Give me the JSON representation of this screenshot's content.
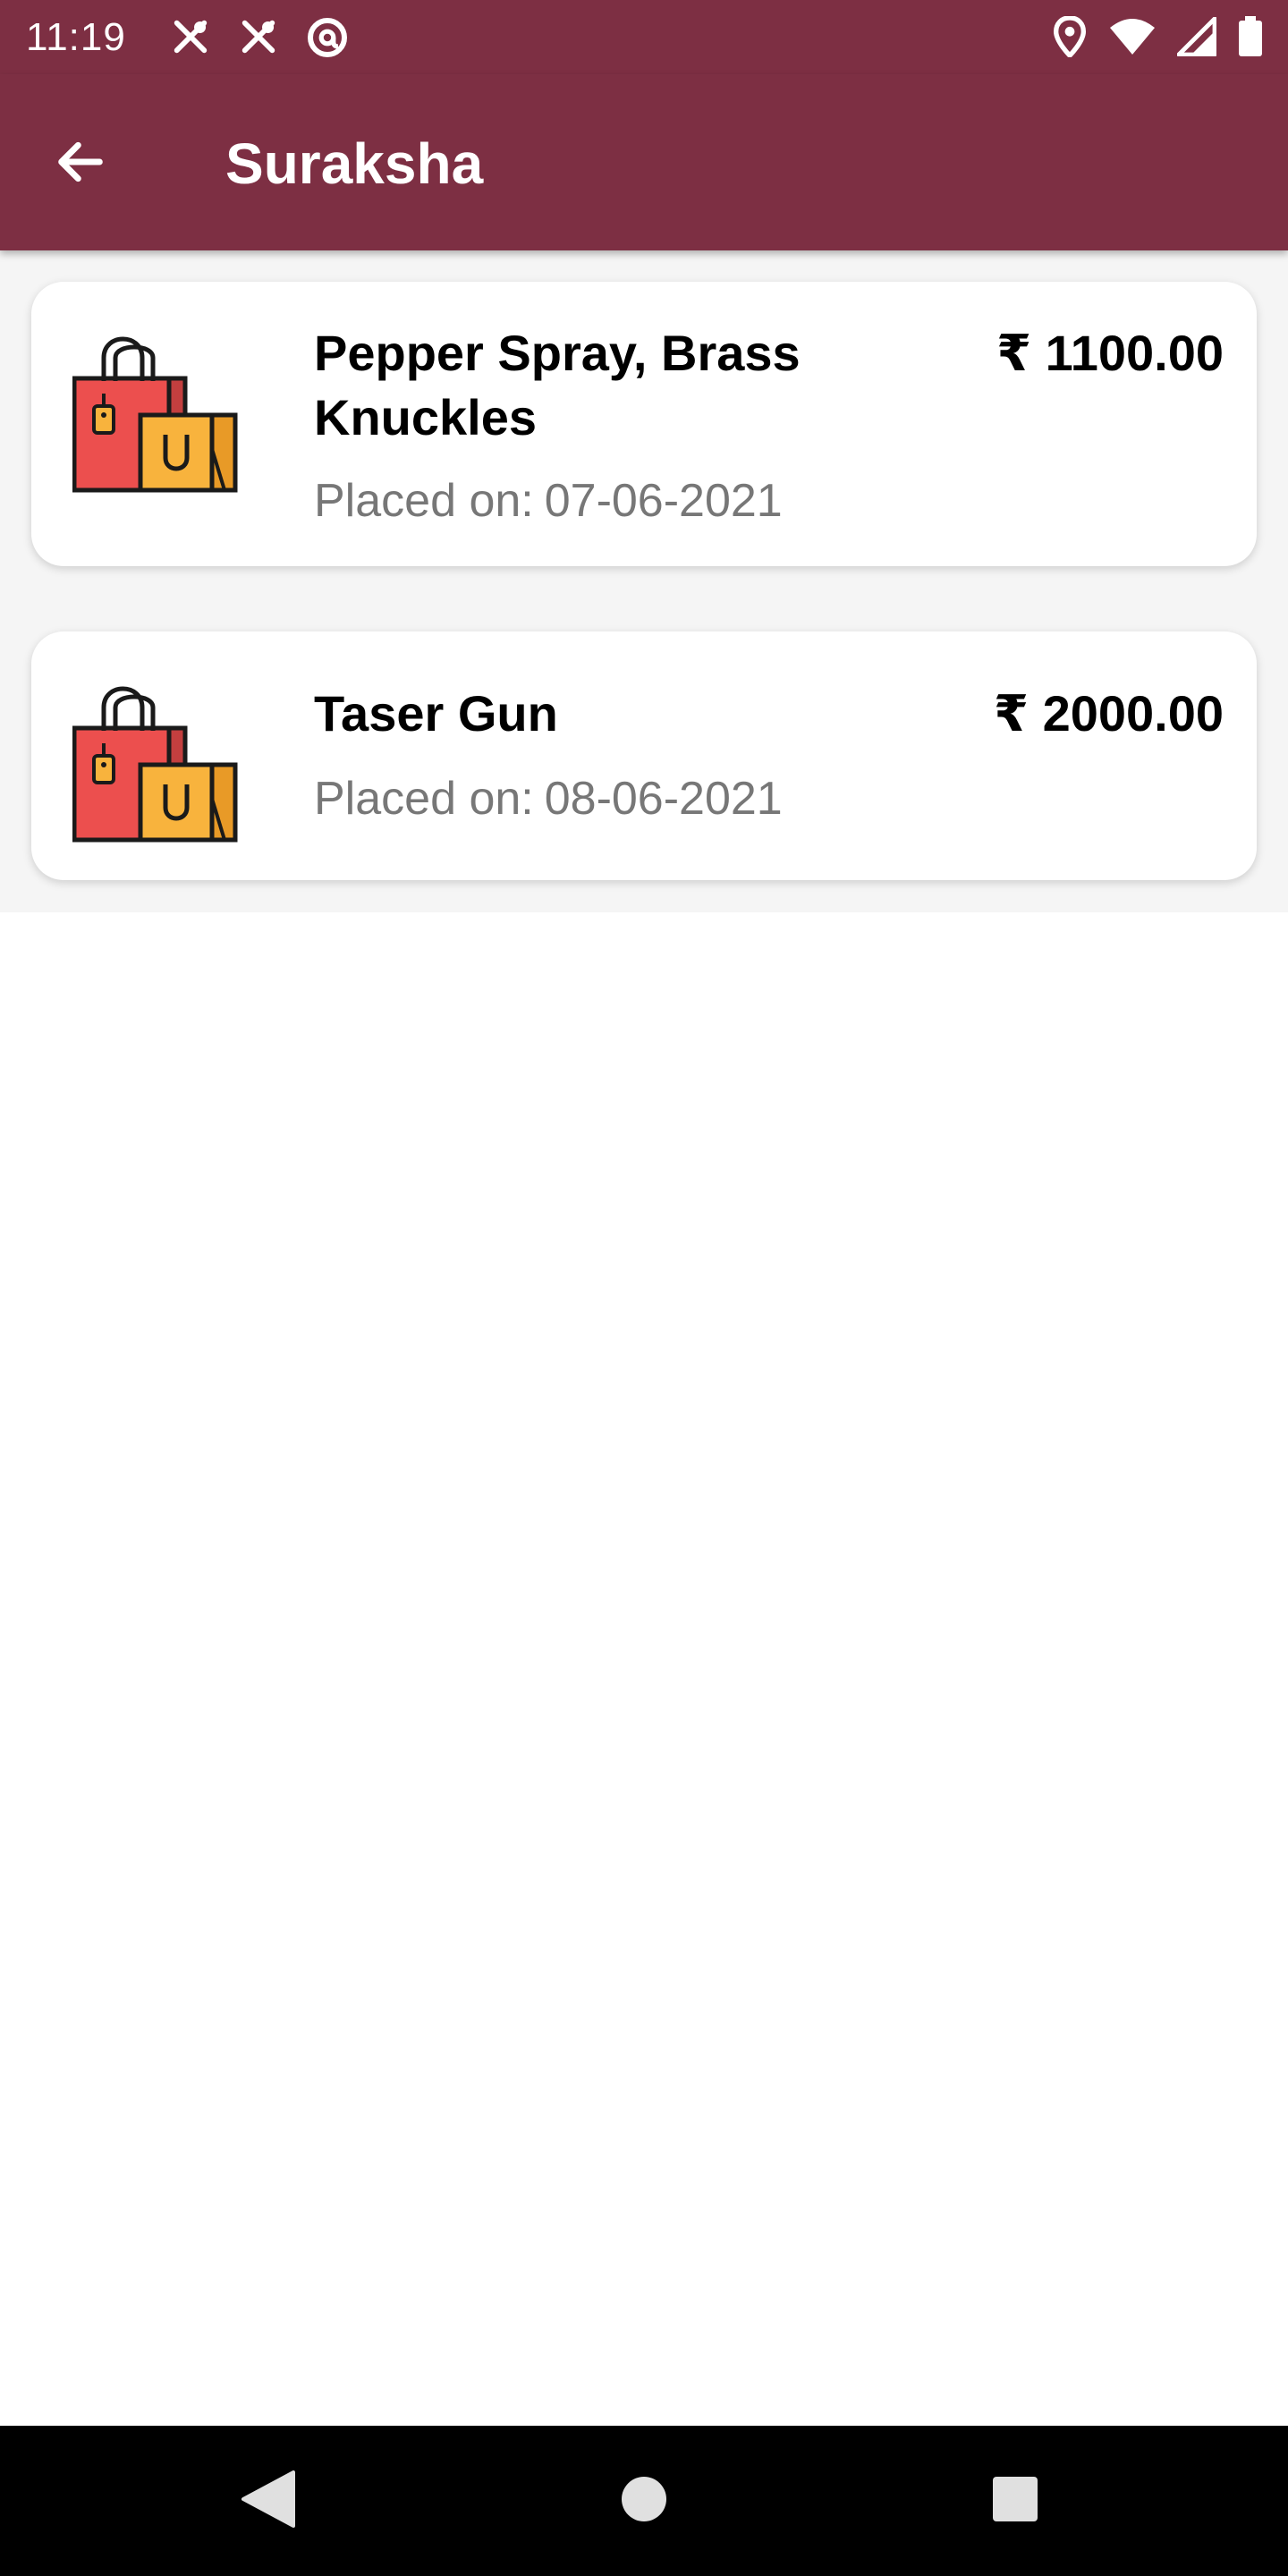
{
  "status_bar": {
    "time": "11:19",
    "left_icons": [
      "utensils-icon",
      "utensils-icon",
      "at-sign-icon"
    ],
    "right_icons": [
      "location-pin-icon",
      "wifi-icon",
      "signal-icon",
      "battery-icon"
    ]
  },
  "app_bar": {
    "title": "Suraksha",
    "back_icon": "arrow-left-icon"
  },
  "orders": [
    {
      "icon": "shopping-bags-icon",
      "name": "Pepper Spray, Brass Knuckles",
      "price": "₹ 1100.00",
      "date_prefix": "Placed on:",
      "date": "07-06-2021"
    },
    {
      "icon": "shopping-bags-icon",
      "name": "Taser Gun",
      "price": "₹ 2000.00",
      "date_prefix": "Placed on:",
      "date": "08-06-2021"
    }
  ],
  "nav_bar": {
    "back_icon": "nav-back-triangle-icon",
    "home_icon": "nav-home-circle-icon",
    "recents_icon": "nav-recents-square-icon"
  },
  "colors": {
    "primary": "#7d2f43",
    "list_background": "#f5f5f5",
    "card_background": "#ffffff",
    "secondary_text": "#777777",
    "bag_red": "#ec4f4e",
    "bag_yellow": "#f8b33d"
  }
}
